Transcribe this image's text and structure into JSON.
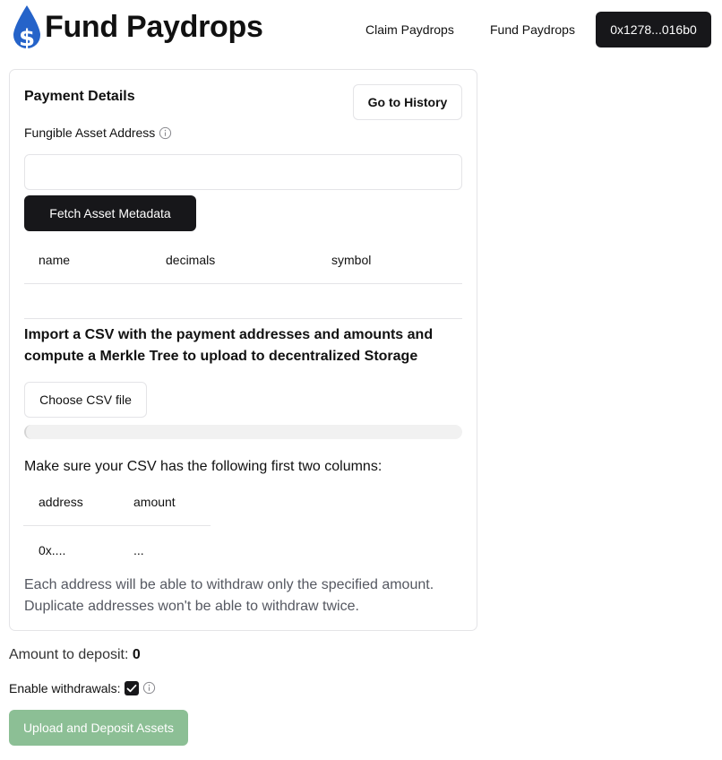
{
  "header": {
    "title": "Fund Paydrops",
    "logo_icon": "droplet-dollar-icon",
    "brand_color": "#2563c9",
    "nav": {
      "claim_label": "Claim Paydrops",
      "fund_label": "Fund Paydrops"
    },
    "wallet_label": "0x1278...016b0"
  },
  "payment": {
    "title": "Payment Details",
    "history_label": "Go to History",
    "asset_label": "Fungible Asset Address",
    "asset_value": "",
    "fetch_label": "Fetch Asset Metadata",
    "metadata_columns": [
      "name",
      "decimals",
      "symbol"
    ]
  },
  "csv": {
    "heading": "Import a CSV with the payment addresses and amounts and compute a Merkle Tree to upload to decentralized Storage",
    "choose_label": "Choose CSV file",
    "progress": 0,
    "hint": "Make sure your CSV has the following first two columns:",
    "columns": [
      "address",
      "amount"
    ],
    "example_row": [
      "0x....",
      "..."
    ],
    "note": "Each address will be able to withdraw only the specified amount. Duplicate addresses won't be able to withdraw twice."
  },
  "deposit": {
    "label": "Amount to deposit:",
    "value": "0"
  },
  "withdrawals": {
    "label": "Enable withdrawals:",
    "checked": true
  },
  "upload_label": "Upload and Deposit Assets",
  "colors": {
    "primary_button": "#17171a",
    "disabled_button": "#8cbf95",
    "border": "#e4e4e7"
  }
}
